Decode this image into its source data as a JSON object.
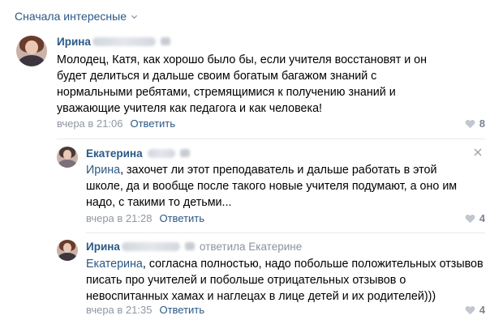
{
  "sort": {
    "label": "Сначала интересные"
  },
  "comments": [
    {
      "author": "Ирина",
      "text": "Молодец, Катя, как хорошо было бы, если учителя восстановят и он будет делиться и дальше своим богатым багажом знаний с нормальными ребятами, стремящимися к получению знаний и уважающие учителя как педагога и как человека!",
      "date": "вчера в 21:06",
      "reply_label": "Ответить",
      "likes": "8"
    },
    {
      "author": "Екатерина",
      "mention": "Ирина",
      "text": ", захочет ли этот преподаватель и дальше работать в этой школе, да и вообще после такого новые учителя подумают, а оно им надо, с такими то детьми...",
      "date": "вчера в 21:28",
      "reply_label": "Ответить",
      "likes": "4"
    },
    {
      "author": "Ирина",
      "reply_to": "ответила Екатерине",
      "mention": "Екатерина",
      "text": ", согласна полностью, надо побольше положительных отзывов писать про учителей и побольше отрицательных отзывов о невоспитанных хамах и наглецах в лице детей и их родителей)))",
      "date": "вчера в 21:35",
      "reply_label": "Ответить",
      "likes": "4"
    }
  ],
  "colors": {
    "link": "#2a5885",
    "meta": "#8f97a1",
    "divider": "#e7e8ec"
  }
}
